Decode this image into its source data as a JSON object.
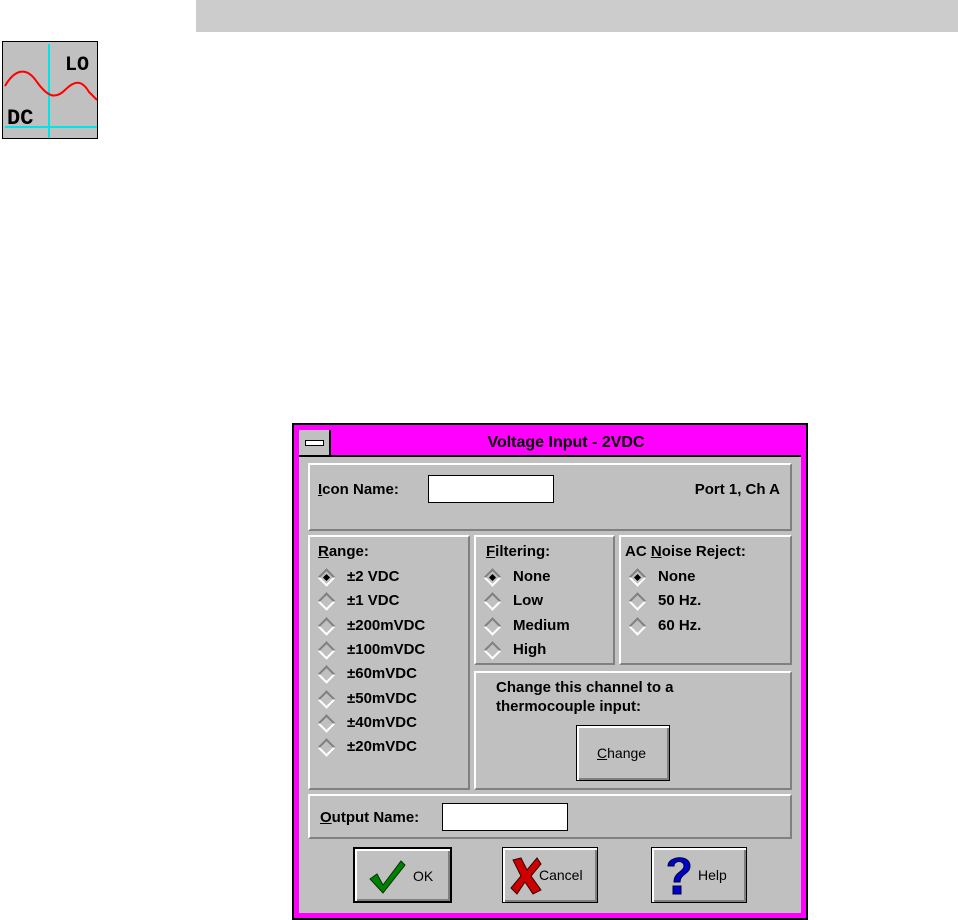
{
  "icon": {
    "top_label": "LO",
    "bottom_label": "DC",
    "name": "voltage-dc-icon"
  },
  "dialog": {
    "title": "Voltage Input - 2VDC",
    "icon_name": {
      "label_prefix": "",
      "label_underlined": "I",
      "label_rest": "con Name:",
      "value": ""
    },
    "port": "Port 1, Ch A",
    "range": {
      "label_underlined": "R",
      "label_rest": "ange:",
      "options": [
        "±2 VDC",
        "±1 VDC",
        "±200mVDC",
        "±100mVDC",
        "±60mVDC",
        "±50mVDC",
        "±40mVDC",
        "±20mVDC"
      ],
      "selected": 0
    },
    "filtering": {
      "label_underlined": "F",
      "label_rest": "iltering:",
      "options": [
        "None",
        "Low",
        "Medium",
        "High"
      ],
      "selected": 0
    },
    "ac_noise": {
      "label_prefix": "AC ",
      "label_underlined": "N",
      "label_rest": "oise Reject:",
      "options": [
        "None",
        "50 Hz.",
        "60 Hz."
      ],
      "selected": 0
    },
    "change": {
      "line1": "Change this channel to a",
      "line2": "thermocouple input:",
      "button_underlined": "C",
      "button_rest": "hange"
    },
    "output_name": {
      "label_underlined": "O",
      "label_rest": "utput Name:",
      "value": ""
    },
    "buttons": {
      "ok": "OK",
      "cancel": "Cancel",
      "help": "Help"
    }
  },
  "colors": {
    "titlebar": "#ff00ff",
    "face": "#c0c0c0",
    "topbar": "#cccccc",
    "check_green": "#008000",
    "x_red": "#cc0000",
    "help_blue": "#0000cc"
  }
}
